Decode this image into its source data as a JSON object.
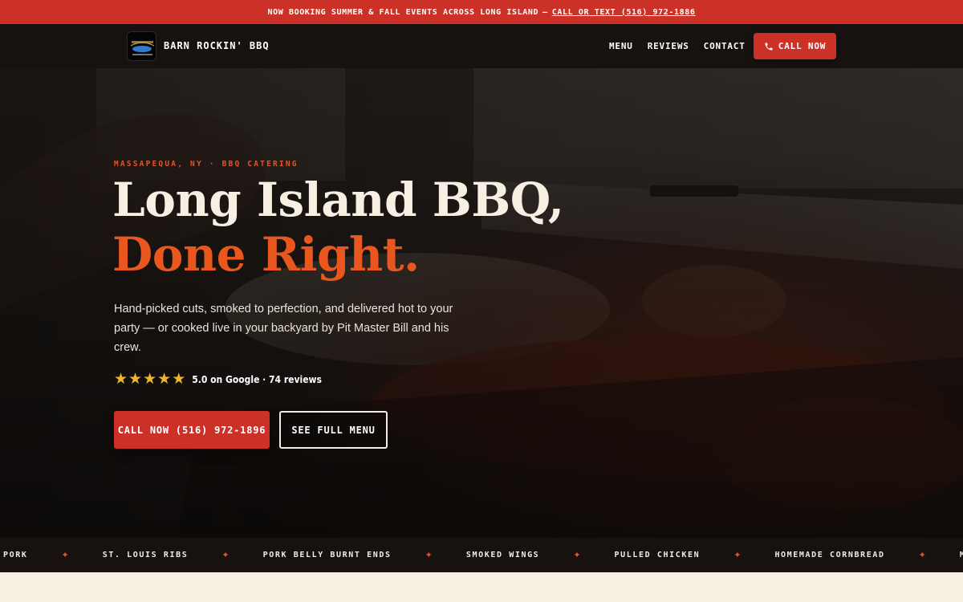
{
  "announcement": {
    "text": "NOW BOOKING SUMMER & FALL EVENTS ACROSS LONG ISLAND",
    "separator": "—",
    "link_text": "CALL OR TEXT (516) 972-1886"
  },
  "nav": {
    "brand": "BARN ROCKIN' BBQ",
    "links": [
      "MENU",
      "REVIEWS",
      "CONTACT"
    ],
    "call_label": "CALL NOW",
    "call_icon": "phone-icon"
  },
  "hero": {
    "eyebrow": "MASSAPEQUA, NY · BBQ CATERING",
    "headline_line1": "Long Island BBQ,",
    "headline_line2": "Done Right.",
    "subtext": "Hand-picked cuts, smoked to perfection, and delivered hot to your party — or cooked live in your backyard by Pit Master Bill and his crew.",
    "rating": {
      "stars": 5,
      "max_stars": 5,
      "text": "5.0 on Google · 74 reviews"
    },
    "primary_button": "CALL NOW (516) 972-1896",
    "secondary_button": "SEE FULL MENU"
  },
  "ticker": {
    "items": [
      "PORK",
      "ST. LOUIS RIBS",
      "PORK BELLY BURNT ENDS",
      "SMOKED WINGS",
      "PULLED CHICKEN",
      "HOMEMADE CORNBREAD",
      "MAC &"
    ],
    "separator": "✦"
  },
  "colors": {
    "accent_red": "#cc3128",
    "accent_orange": "#e9571f",
    "dark": "#171210",
    "cream": "#f6efe2",
    "star": "#f4b428"
  }
}
